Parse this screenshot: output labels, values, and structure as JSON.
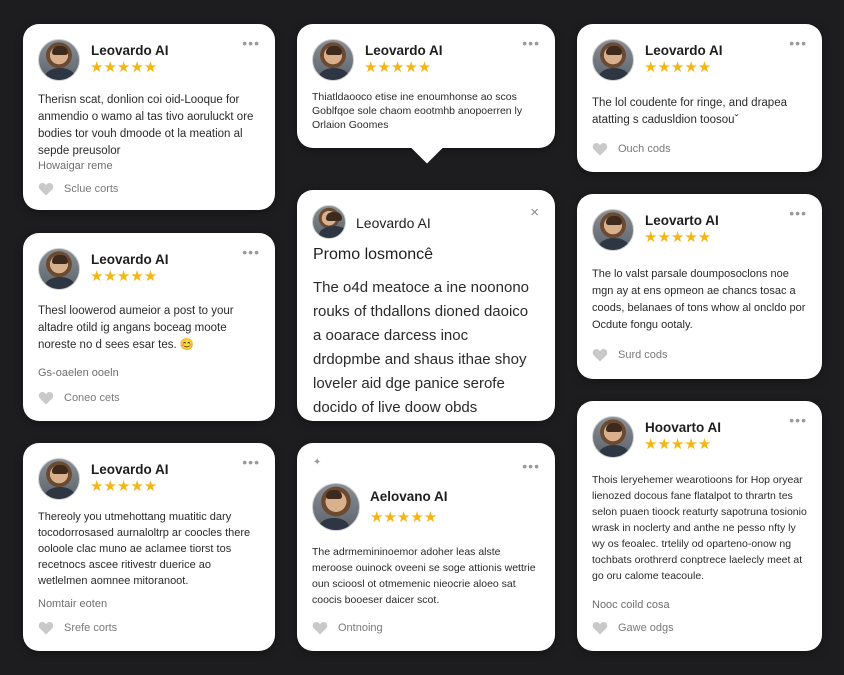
{
  "colors": {
    "background": "#1d1d1f",
    "card": "#ffffff",
    "star": "#f4b614"
  },
  "icons": {
    "more": "more-horizontal-icon",
    "like": "heart-icon",
    "close": "close-icon"
  },
  "cards": [
    {
      "name": "Leovardo AI",
      "stars": "★★★★★",
      "text": "Therisn scat, donlion coi oid-Looque for anmendio o wamo al tas tivo aoruluckt ore bodies tor vouh dmoode ot la meation al sepde preusolor",
      "meta": "Howaigar reme",
      "likes": "Sclue corts"
    },
    {
      "name": "Leovardo AI",
      "stars": "★★★★★",
      "text": "Thiatldaooco etise ine enoumhonse ao scos Goblfqoe sole chaom eootmhb anopoerren ly Orlaion Goomes"
    },
    {
      "name": "Leovardo AI",
      "stars": "★★★★★",
      "text": "The lol coudente for ringe, and drapea atatting s cadusldion toosouˇ",
      "likes": "Ouch cods"
    },
    {
      "name": "Leovardo AI",
      "stars": "★★★★★",
      "text": "Thesl loowerod aumeior a post to your altadre otild ig angans boceag moote noreste no d sees esar tes. 😊",
      "meta": "Gs-oaelen ooeln",
      "likes": "Coneo cets"
    },
    {
      "name": "Leovardo AI",
      "title": "Promo losmoncê",
      "text": "The o4d meatoce a ine noonono rouks of thdallons dioned daoico a ooarace darcess inoc drdopmbe and shaus ithae shoy loveler aid dge panice serofe docido of live doow obds"
    },
    {
      "name": "Leovarto AI",
      "stars": "★★★★★",
      "text": "The lo valst parsale doumposoclons noe mgn ay at ens opmeon ae chancs tosac a coods, belanaes of tons whow al oncldo por Ocdute fongu ootaly.",
      "likes": "Surd cods"
    },
    {
      "name": "Leovardo AI",
      "stars": "★★★★★",
      "text": "Thereoly you utmehottang muatitic dary tocodorrosased aurnaloltrp ar coocles there ooloole clac muno ae aclamee tiorst tos recetnocs ascee ritivestr duerice ao wetlelmen aomnee mitoranoot.",
      "meta": "Nomtair eoten",
      "likes": "Srefe corts"
    },
    {
      "name": "Aelovano AI",
      "stars": "★★★★★",
      "text": "The adrmemininoemor adoher leas alste meroose ouinock oveeni se soge attionis wettrie oun scioosl ot otmemenic nieocrie aloeo sat coocis booeser daicer scot.",
      "likes": "Ontnoing"
    },
    {
      "name": "Hoovarto AI",
      "stars": "★★★★★",
      "text": "Thois leryehemer wearotioons for Hop oryear lienozed docous fane flatalpot to thrartn tes selon puaen tioock reaturty sapotruna tosionio wrask in noclerty and anthe ne pesso nfty ly wy os feoalec. trtelily od oparteno-onow ng tochbats orothrerd conptrece laelecly meet at go oru calome teacoule.",
      "meta": "Nooc coild cosa",
      "likes": "Gawe odgs"
    }
  ]
}
